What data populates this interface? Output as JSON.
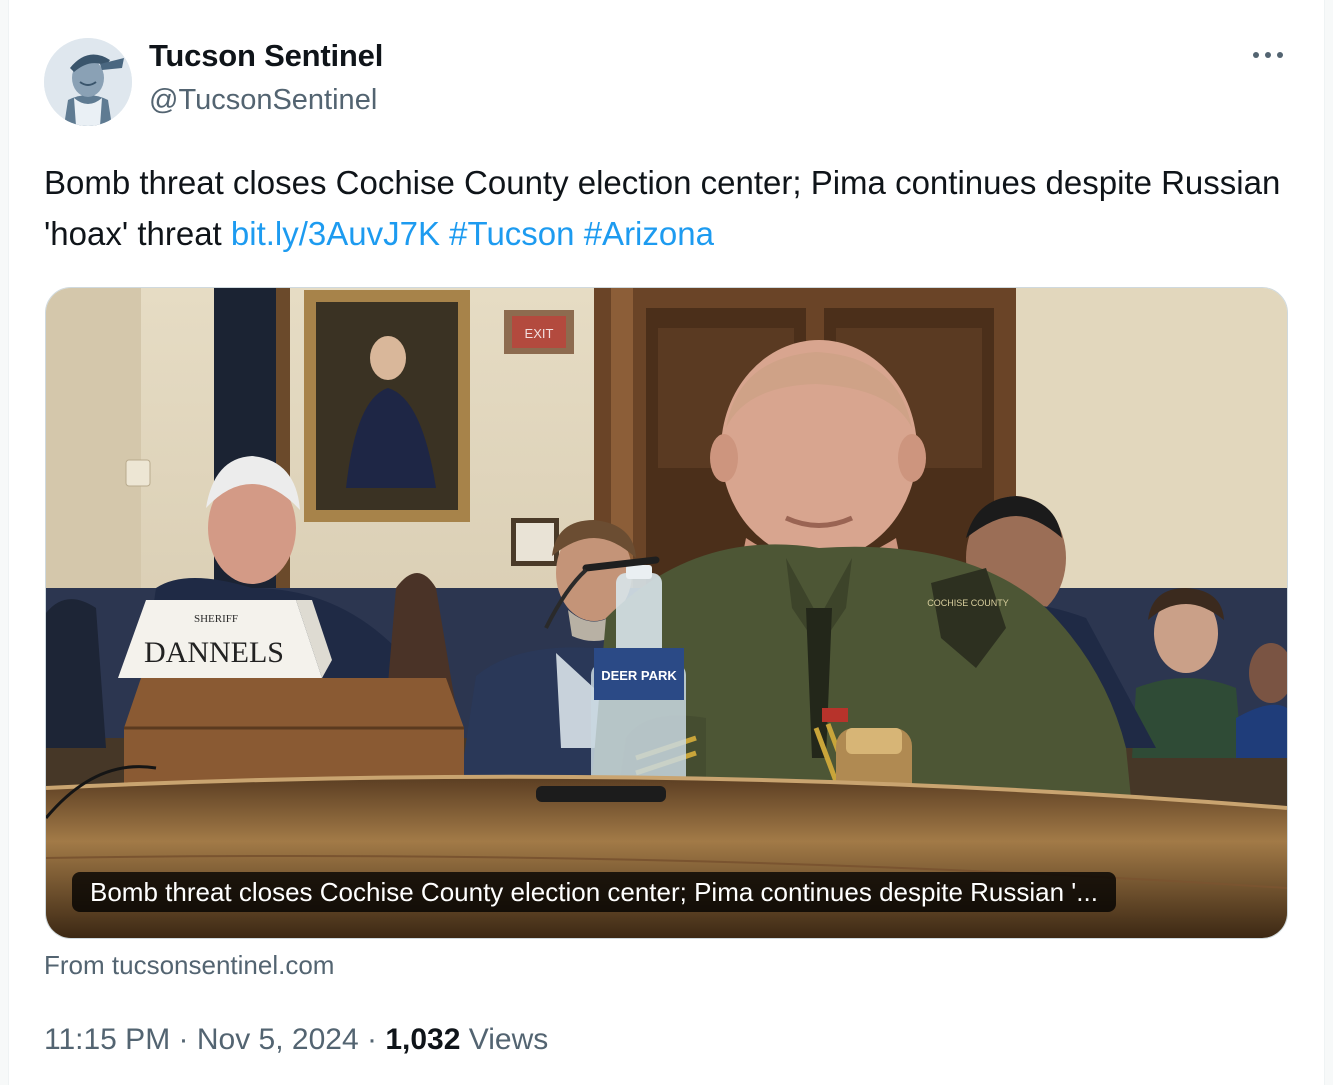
{
  "author": {
    "display_name": "Tucson Sentinel",
    "handle": "@TucsonSentinel"
  },
  "tweet": {
    "text": "Bomb threat closes Cochise County election center; Pima continues despite Russian 'hoax' threat ",
    "link": "bit.ly/3AuvJ7K",
    "hashtags": [
      "#Tucson",
      "#Arizona"
    ]
  },
  "card": {
    "caption": "Bomb threat closes Cochise County election center; Pima continues despite Russian '...",
    "nameplate_top": "SHERIFF",
    "nameplate_name": "DANNELS",
    "exit_sign": "EXIT",
    "bottle_label": "DEER PARK",
    "patch_text": "COCHISE COUNTY",
    "source": "From tucsonsentinel.com"
  },
  "meta": {
    "time": "11:15 PM",
    "separator": "·",
    "date": "Nov 5, 2024",
    "views_count": "1,032",
    "views_label": "Views"
  },
  "icons": {
    "more": "more-horizontal-icon"
  }
}
